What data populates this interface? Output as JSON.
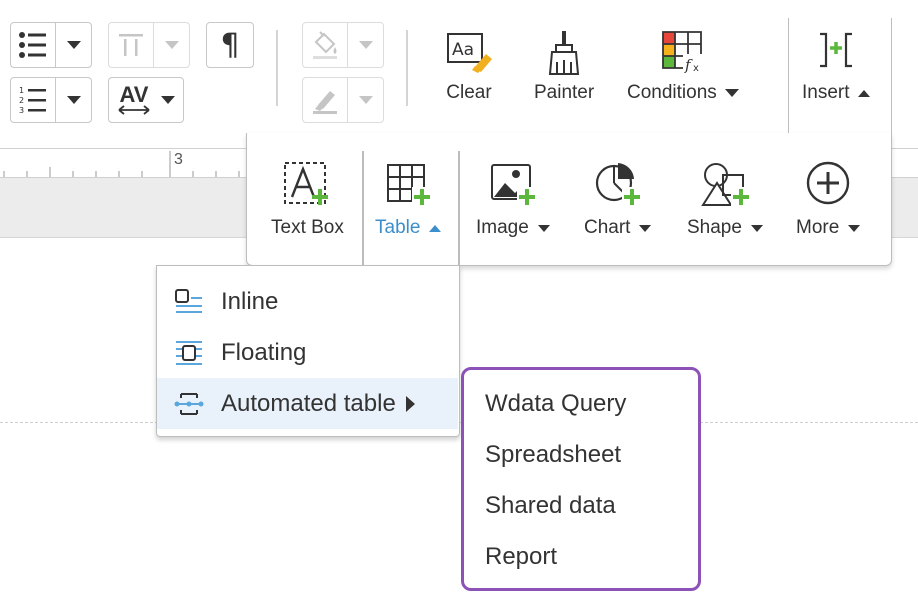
{
  "ruler": {
    "mark": "3"
  },
  "ribbon": {
    "clear_label": "Clear",
    "painter_label": "Painter",
    "conditions_label": "Conditions",
    "insert_label": "Insert",
    "insert_icon_text": "]+[",
    "paragraph_glyph": "¶",
    "spacing_glyph": "AV",
    "icons": {
      "bullet_list": "bullet-list-icon",
      "numbered_list": "numbered-list-icon",
      "vertical_align": "vertical-align-icon",
      "paragraph": "paragraph-mark-icon",
      "char_spacing": "character-spacing-icon",
      "fill": "fill-bucket-icon",
      "highlighter": "highlighter-icon",
      "clear": "clear-format-icon",
      "painter": "format-painter-icon",
      "conditions": "conditional-format-icon",
      "insert": "insert-icon"
    }
  },
  "insert_panel": {
    "text_box": "Text Box",
    "table": "Table",
    "image": "Image",
    "chart": "Chart",
    "shape": "Shape",
    "more": "More"
  },
  "table_menu": {
    "items": [
      {
        "label": "Inline"
      },
      {
        "label": "Floating"
      },
      {
        "label": "Automated table"
      }
    ]
  },
  "automated_table_menu": {
    "items": [
      "Wdata Query",
      "Spreadsheet",
      "Shared data",
      "Report"
    ]
  },
  "colors": {
    "accent_blue": "#3d8fcc",
    "plus_green": "#5cb83c",
    "submenu_border": "#8c52b8",
    "highlight_bg": "#e9f2fb"
  }
}
